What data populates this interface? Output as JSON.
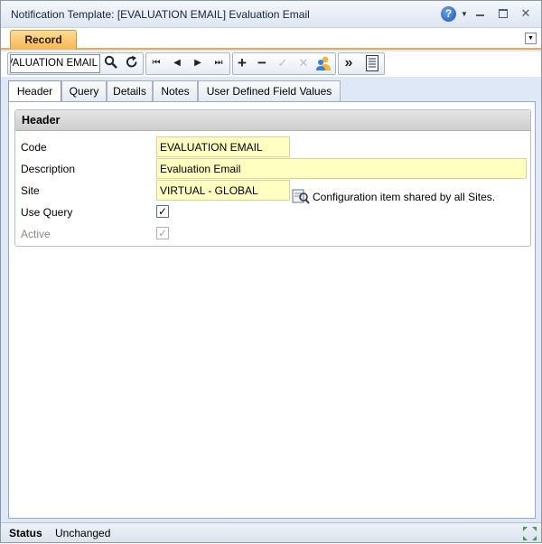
{
  "window": {
    "title": "Notification Template: [EVALUATION EMAIL] Evaluation Email",
    "help_glyph": "?",
    "dropdown_glyph": "▼",
    "close_glyph": "✕"
  },
  "tabstrip": {
    "record_tab": "Record",
    "menu_glyph": "▼"
  },
  "toolbar": {
    "record_value": "EVALUATION EMAIL",
    "icons": [
      "search-icon",
      "refresh-icon",
      "first-record-icon",
      "previous-record-icon",
      "next-record-icon",
      "last-record-icon",
      "add-icon",
      "delete-icon",
      "save-icon",
      "cancel-icon",
      "users-icon",
      "more-icon",
      "list-icon"
    ],
    "glyphs": {
      "first": "⏮",
      "previous": "◀",
      "next": "▶",
      "last": "⏭",
      "add": "+",
      "delete": "−",
      "save": "✓",
      "cancel": "✕",
      "more": "»"
    }
  },
  "subtabs": [
    {
      "label": "Header",
      "active": true
    },
    {
      "label": "Query",
      "active": false
    },
    {
      "label": "Details",
      "active": false
    },
    {
      "label": "Notes",
      "active": false
    },
    {
      "label": "User Defined Field Values",
      "active": false
    }
  ],
  "header_section": {
    "title": "Header",
    "code_label": "Code",
    "code_value": "EVALUATION EMAIL",
    "description_label": "Description",
    "description_value": "Evaluation Email",
    "site_label": "Site",
    "site_value": "VIRTUAL - GLOBAL",
    "site_note": "Configuration item shared by all Sites.",
    "use_query_label": "Use Query",
    "use_query_checked": true,
    "active_label": "Active",
    "active_checked": true,
    "check_glyph": "✓"
  },
  "status": {
    "label": "Status",
    "value": "Unchanged"
  },
  "colors": {
    "accent_tab": "#f6b656",
    "required_field": "#ffffc2",
    "window_bg": "#dfe8f6"
  }
}
